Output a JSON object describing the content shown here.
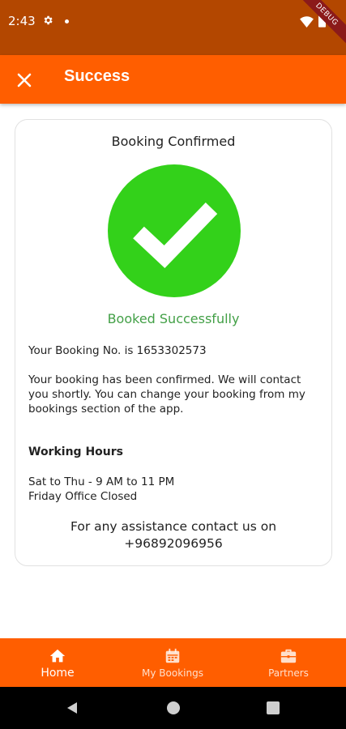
{
  "status_bar": {
    "time": "2:43",
    "debug_label": "DEBUG"
  },
  "app_bar": {
    "title": "Success"
  },
  "card": {
    "title": "Booking Confirmed",
    "success_message": "Booked Successfully",
    "booking_number_line": "Your Booking No. is 1653302573",
    "message": "Your booking has been confirmed. We will contact you shortly. You can change your booking from my bookings section of the app.",
    "working_hours_heading": "Working Hours",
    "working_hours_line1": "Sat to Thu - 9 AM to 11 PM",
    "working_hours_line2": "Friday Office Closed",
    "assistance_line1": "For any assistance contact us on",
    "assistance_line2": "+96892096956"
  },
  "bottom_nav": {
    "items": [
      {
        "label": "Home",
        "icon": "home-icon",
        "active": true
      },
      {
        "label": "My Bookings",
        "icon": "calendar-icon",
        "active": false
      },
      {
        "label": "Partners",
        "icon": "briefcase-icon",
        "active": false
      }
    ]
  },
  "colors": {
    "status_bar": "#b34700",
    "primary": "#ff5e00",
    "success_green": "#33d11a",
    "success_text": "#43a047"
  }
}
